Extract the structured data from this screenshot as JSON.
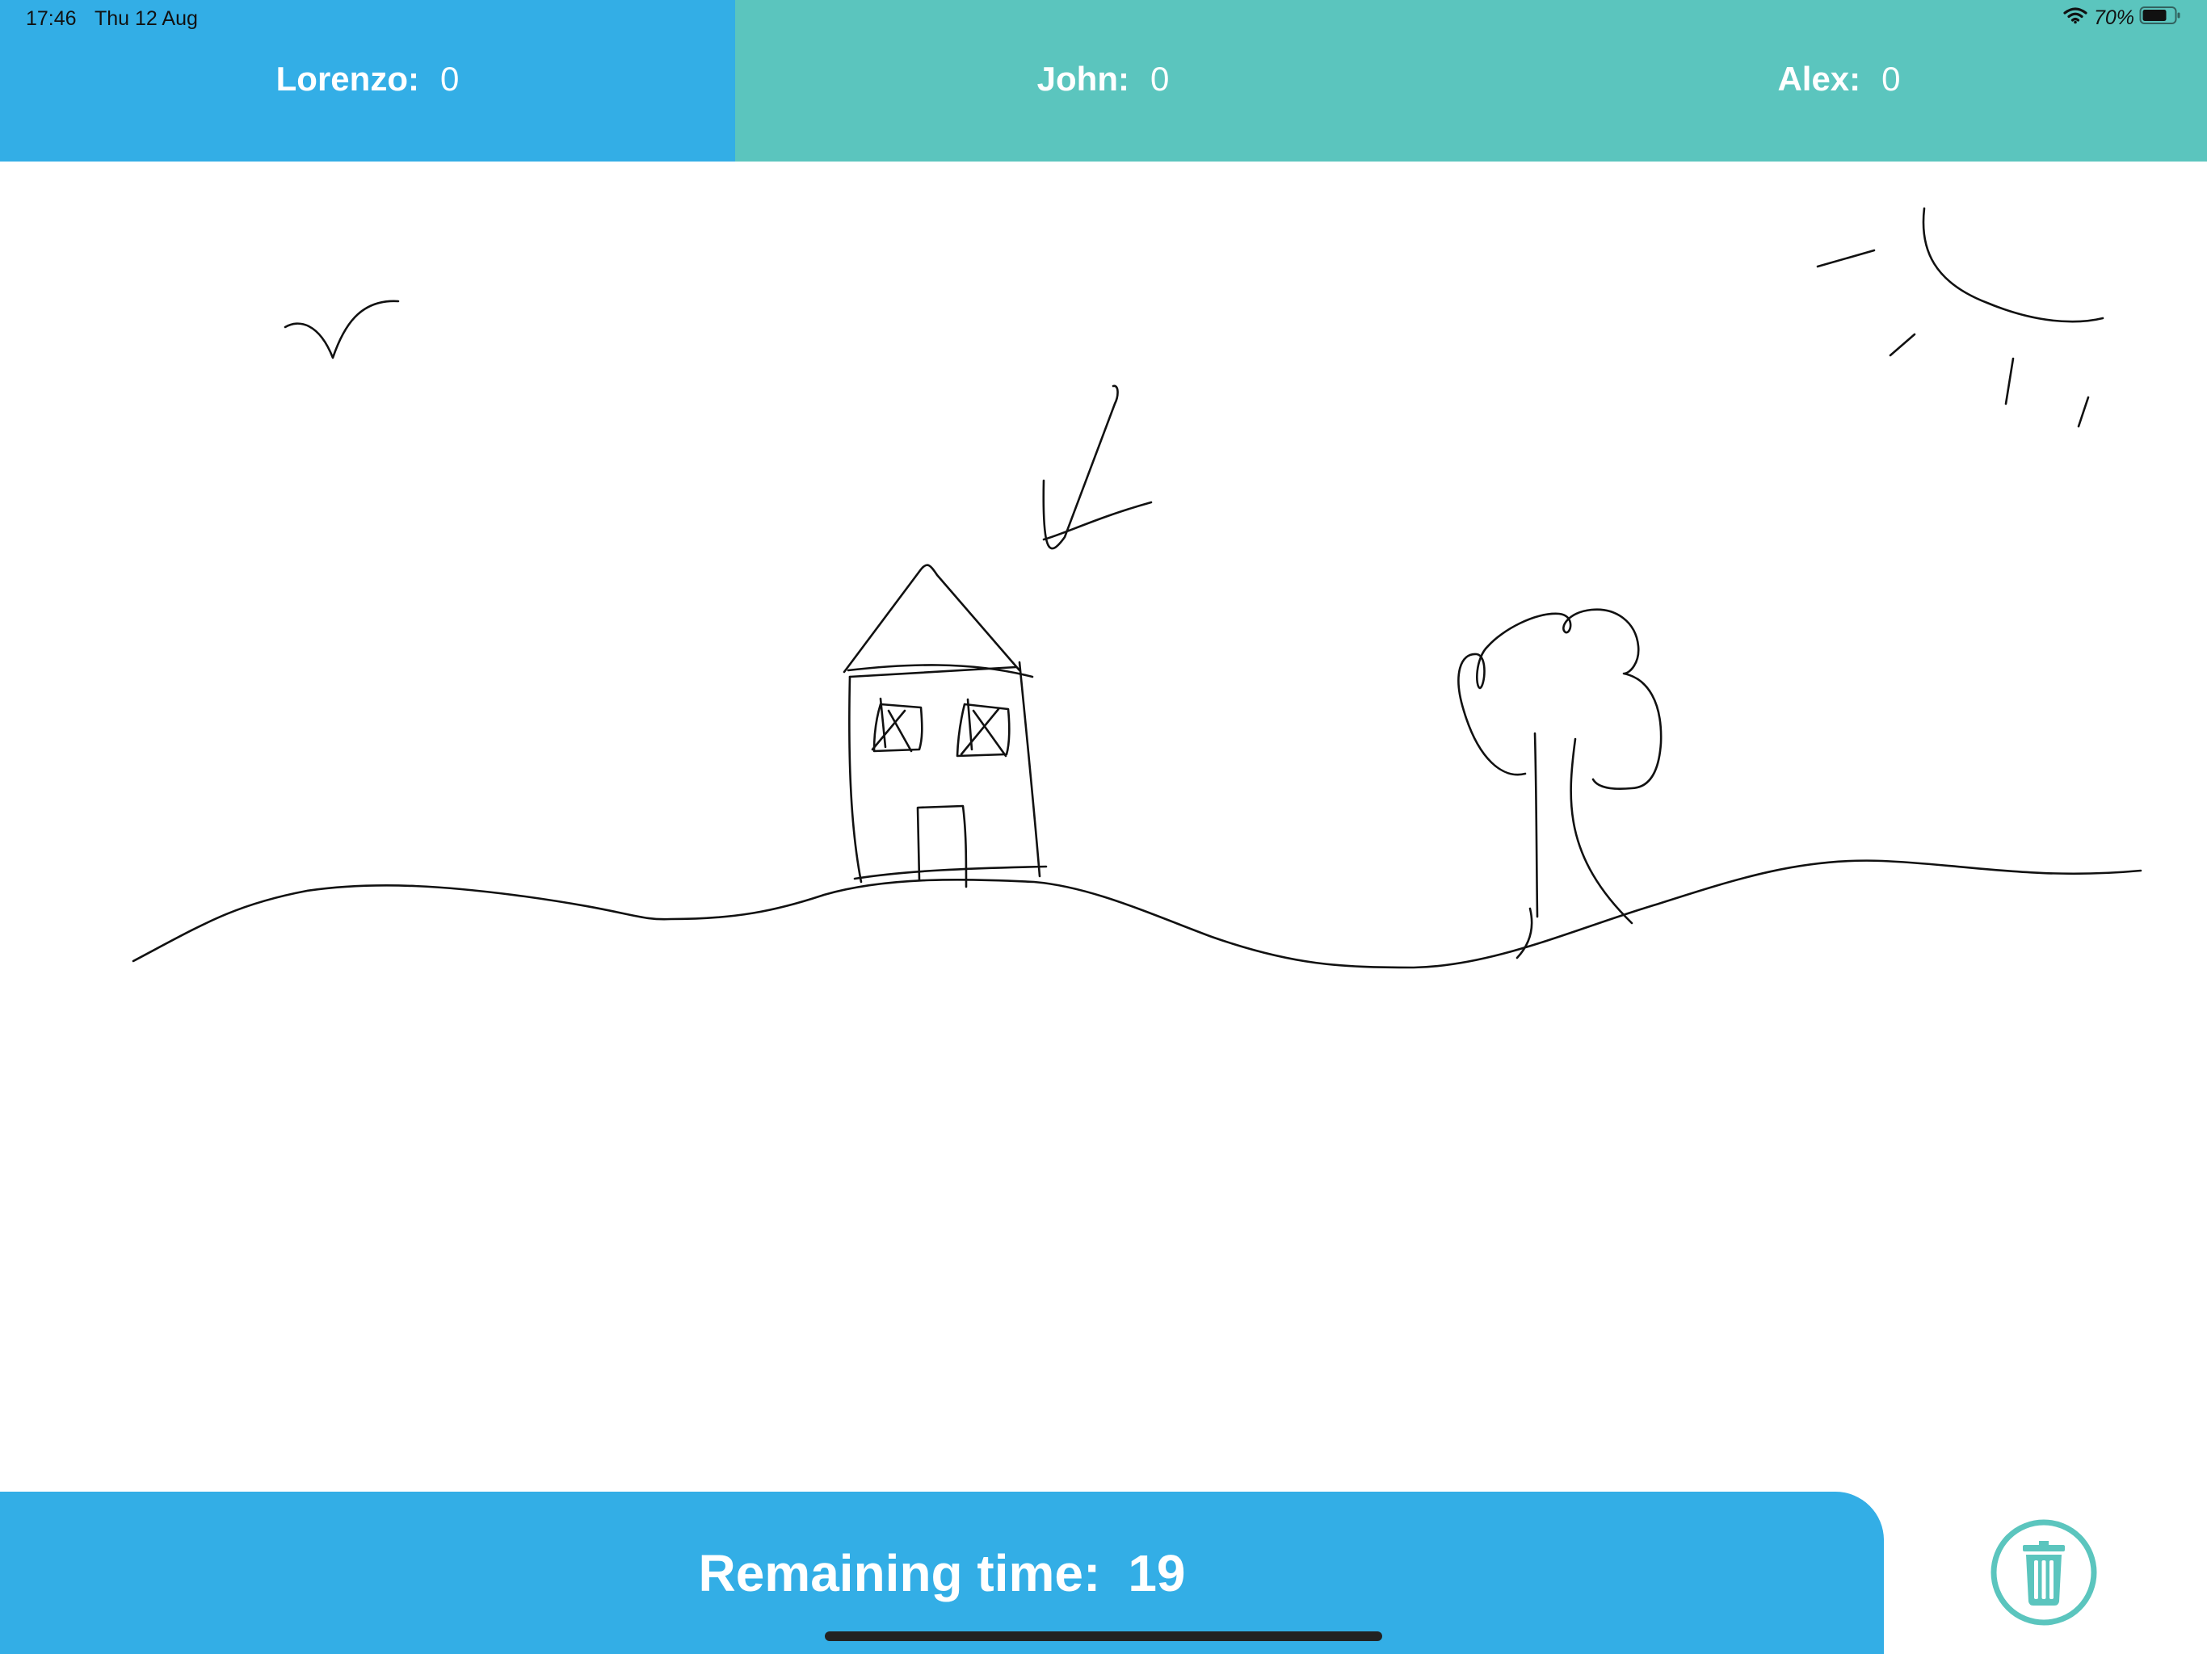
{
  "status_bar": {
    "time": "17:46",
    "date": "Thu 12 Aug",
    "battery": "70%",
    "icons": [
      "wifi-icon",
      "battery-icon"
    ]
  },
  "players": [
    {
      "name": "Lorenzo",
      "separator": ":",
      "score": "0",
      "active": true
    },
    {
      "name": "John",
      "separator": ":",
      "score": "0",
      "active": false
    },
    {
      "name": "Alex",
      "separator": ":",
      "score": "0",
      "active": false
    }
  ],
  "timer": {
    "label": "Remaining time:",
    "value": "19"
  },
  "trash": {
    "icon": "trash-icon"
  },
  "colors": {
    "active_player": "#33AEE6",
    "inactive_player": "#5BC5BE",
    "timer_bar": "#33AEE6",
    "trash_accent": "#5BC5BE",
    "ink": "#111111"
  }
}
